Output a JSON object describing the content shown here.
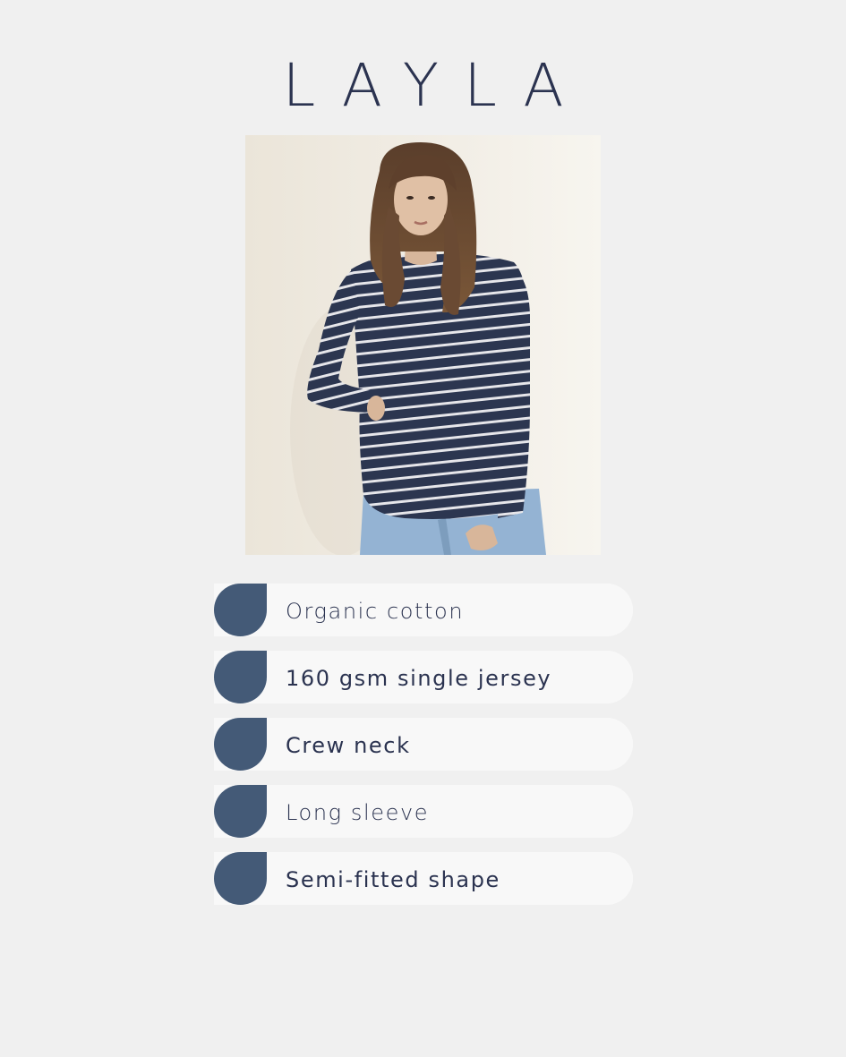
{
  "brand": {
    "title": "LAYLA"
  },
  "photo": {
    "alt": "Model wearing navy and white striped long sleeve top with light blue jeans"
  },
  "features": [
    {
      "label": "Organic cotton",
      "weight": "light"
    },
    {
      "label": "160 gsm single jersey",
      "weight": "medium"
    },
    {
      "label": "Crew neck",
      "weight": "medium"
    },
    {
      "label": "Long sleeve",
      "weight": "light"
    },
    {
      "label": "Semi-fitted shape",
      "weight": "medium"
    }
  ],
  "colors": {
    "background": "#f0f0f0",
    "text": "#2b3350",
    "marker": "#445a77",
    "pill": "#f8f8f8",
    "stripe_navy": "#2c3650",
    "stripe_white": "#e6e6ea"
  }
}
